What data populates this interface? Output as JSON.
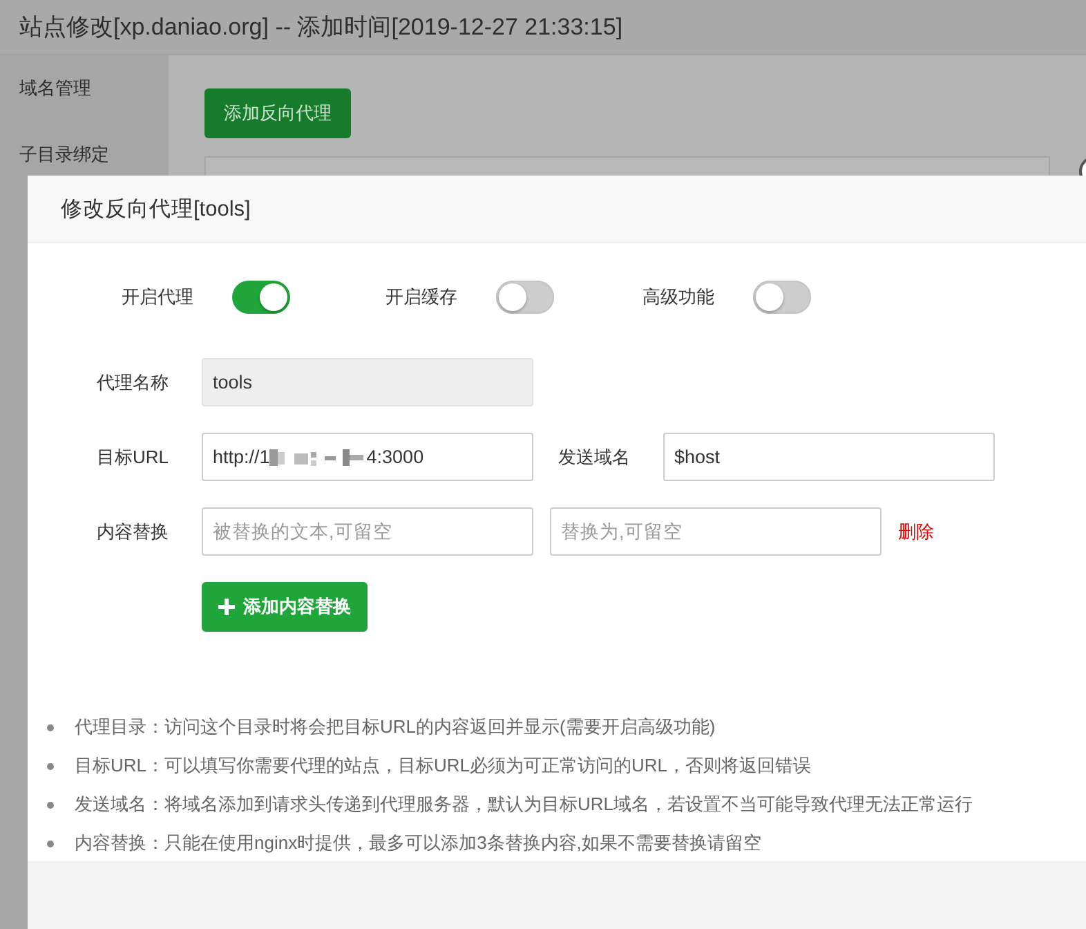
{
  "page": {
    "title": "站点修改[xp.daniao.org] -- 添加时间[2019-12-27 21:33:15]",
    "sidebar": {
      "items": [
        {
          "label": "域名管理"
        },
        {
          "label": "子目录绑定"
        }
      ]
    },
    "add_button": "添加反向代理"
  },
  "dialog": {
    "title": "修改反向代理[tools]",
    "switches": [
      {
        "label": "开启代理",
        "on": true
      },
      {
        "label": "开启缓存",
        "on": false
      },
      {
        "label": "高级功能",
        "on": false
      }
    ],
    "name_field": {
      "label": "代理名称",
      "value": "tools",
      "disabled": true
    },
    "url_field": {
      "label": "目标URL",
      "value_start": "http://1",
      "value_end": "4:3000"
    },
    "host_field": {
      "label": "发送域名",
      "value": "$host"
    },
    "replace": {
      "label": "内容替换",
      "from_placeholder": "被替换的文本,可留空",
      "to_placeholder": "替换为,可留空",
      "delete_link": "删除"
    },
    "add_replace_button": "添加内容替换",
    "notes": [
      "代理目录：访问这个目录时将会把目标URL的内容返回并显示(需要开启高级功能)",
      "目标URL：可以填写你需要代理的站点，目标URL必须为可正常访问的URL，否则将返回错误",
      "发送域名：将域名添加到请求头传递到代理服务器，默认为目标URL域名，若设置不当可能导致代理无法正常运行",
      "内容替换：只能在使用nginx时提供，最多可以添加3条替换内容,如果不需要替换请留空"
    ]
  }
}
